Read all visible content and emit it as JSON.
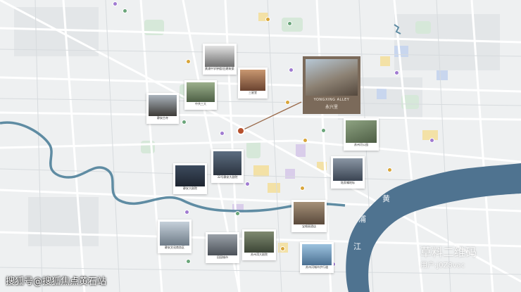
{
  "project": {
    "name_en": "YONGXING ALLEY",
    "name_cn": "永兴里"
  },
  "callouts": [
    {
      "key": "c1",
      "caption": "黄浦中学钟楼/旧建筑保护街区"
    },
    {
      "key": "c2",
      "caption": "中共三大"
    },
    {
      "key": "c3",
      "caption": "三星堂"
    },
    {
      "key": "c4",
      "caption": "静安古寺"
    },
    {
      "key": "c5",
      "caption": "苏州河公园"
    },
    {
      "key": "c6",
      "caption": "32号静安大剧院"
    },
    {
      "key": "c7",
      "caption": "静安大剧院"
    },
    {
      "key": "c8",
      "caption": "陆家嘴地标"
    },
    {
      "key": "c9",
      "caption": "静安文化商务区"
    },
    {
      "key": "c10",
      "caption": "田园城市"
    },
    {
      "key": "c11",
      "caption": "宝格丽酒店"
    },
    {
      "key": "c12",
      "caption": "苏州湾大剧院"
    },
    {
      "key": "c13",
      "caption": "苏州河城市步行道"
    }
  ],
  "river_labels": [
    "黄",
    "浦",
    "江"
  ],
  "watermarks": {
    "left": "搜狐号@搜狐焦点黄石站",
    "right_main": "草料二维码",
    "right_sub": "用户:j0Z8vac"
  },
  "colors": {
    "river": "#4f7390",
    "water_small": "#5f8ca3",
    "road": "#ffffff",
    "park": "#d6e8d9",
    "block_yellow": "#f3e1a6",
    "block_blue": "#c8d6ee",
    "block_purple": "#d9cdea",
    "featured_bg": "#7b6a5a"
  }
}
